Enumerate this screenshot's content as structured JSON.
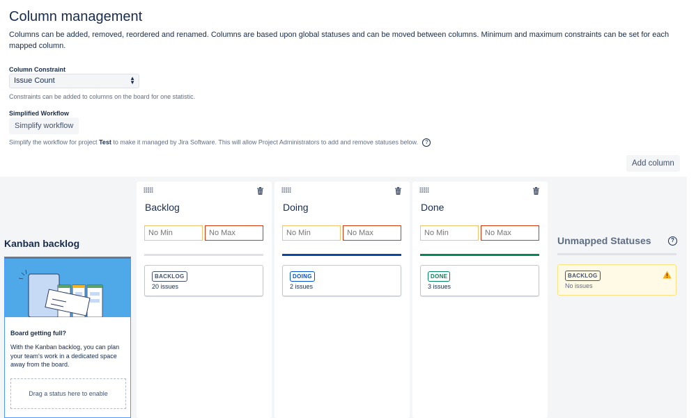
{
  "header": {
    "title": "Column management",
    "description": "Columns can be added, removed, reordered and renamed. Columns are based upon global statuses and can be moved between columns. Minimum and maximum constraints can be set for each mapped column."
  },
  "constraint": {
    "label": "Column Constraint",
    "selected": "Issue Count",
    "helper": "Constraints can be added to columns on the board for one statistic."
  },
  "workflow": {
    "label": "Simplified Workflow",
    "button": "Simplify workflow",
    "helper_before": "Simplify the workflow for project",
    "project": "Test",
    "helper_after": "to make it managed by Jira Software. This will allow Project Administrators to add and remove statuses below.",
    "help_glyph": "?"
  },
  "add_column_label": "Add column",
  "kanban": {
    "title": "Kanban backlog",
    "card_title": "Board getting full?",
    "card_text": "With the Kanban backlog, you can plan your team's work in a dedicated space away from the board.",
    "drop_text": "Drag a status here to enable"
  },
  "columns": [
    {
      "name": "Backlog",
      "min_placeholder": "No Min",
      "max_placeholder": "No Max",
      "bar_color": "#dfe1e6",
      "status": "BACKLOG",
      "status_color": "#42526e",
      "count": "20 issues"
    },
    {
      "name": "Doing",
      "min_placeholder": "No Min",
      "max_placeholder": "No Max",
      "bar_color": "#0747a6",
      "status": "DOING",
      "status_color": "#0052cc",
      "count": "2 issues"
    },
    {
      "name": "Done",
      "min_placeholder": "No Min",
      "max_placeholder": "No Max",
      "bar_color": "#00875a",
      "status": "DONE",
      "status_color": "#00875a",
      "count": "3 issues"
    }
  ],
  "unmapped": {
    "title": "Unmapped Statuses",
    "help_glyph": "?",
    "status": "BACKLOG",
    "status_color": "#42526e",
    "count": "No issues"
  }
}
